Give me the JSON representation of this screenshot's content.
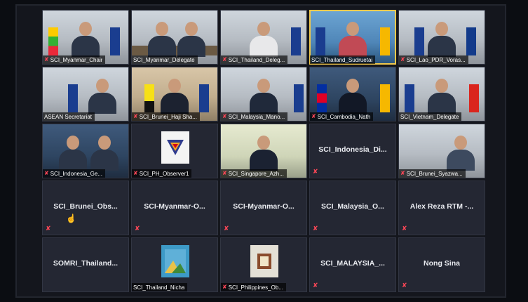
{
  "colors": {
    "mic_muted": "#ff4757",
    "active_speaker": "#f2c94c",
    "tile_bg": "#242733"
  },
  "tiles": [
    {
      "label": "SCI_Myanmar_Chair"
    },
    {
      "label": "SCI_Myanmar_Delegate"
    },
    {
      "label": "SCI_Thailand_Deleg..."
    },
    {
      "label": "SCI_Thailand_Sudruetai"
    },
    {
      "label": "SCI_Lao_PDR_Voras..."
    },
    {
      "label": "ASEAN Secretariat"
    },
    {
      "label": "SCI_Brunei_Haji Sha..."
    },
    {
      "label": "SCI_Malaysia_Mano..."
    },
    {
      "label": "SCI_Cambodia_Nath"
    },
    {
      "label": "SCI_Vietnam_Delegate"
    },
    {
      "label": "SCI_Indonesia_Ge..."
    },
    {
      "label": "SCI_PH_Observer1"
    },
    {
      "label": "SCI_Singapore_Azh..."
    },
    {
      "label": "SCI_Indonesia_Di..."
    },
    {
      "label": "SCI_Brunei_Syazwa..."
    },
    {
      "label": "SCI_Brunei_Obs..."
    },
    {
      "label": "SCI-Myanmar-O..."
    },
    {
      "label": "SCI-Myanmar-O..."
    },
    {
      "label": "SCI_Malaysia_O..."
    },
    {
      "label": "Alex Reza RTM -..."
    },
    {
      "label": "SOMRI_Thailand..."
    },
    {
      "label": "SCI_Thailand_Nicha"
    },
    {
      "label": "SCI_Philippines_Ob..."
    },
    {
      "label": "SCI_MALAYSIA_..."
    },
    {
      "label": "Nong Sina"
    }
  ],
  "icons": {
    "muted": "mic-muted-icon",
    "cursor": "hand-cursor-icon"
  }
}
